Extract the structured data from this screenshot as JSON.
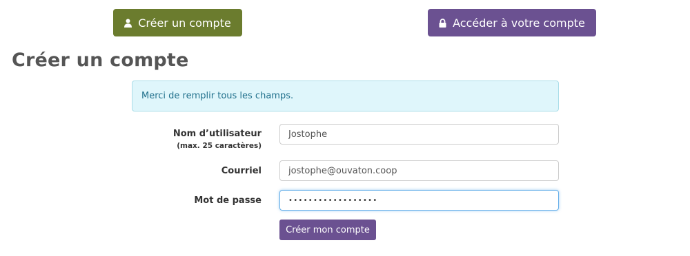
{
  "header": {
    "create_account_button": {
      "label": "Créer un compte",
      "icon": "user-icon"
    },
    "login_button": {
      "label": "Accéder à votre compte",
      "icon": "lock-icon"
    }
  },
  "page": {
    "title": "Créer un compte",
    "alert": "Merci de remplir tous les champs."
  },
  "form": {
    "username": {
      "label": "Nom d’utilisateur",
      "hint": "(max. 25 caractères)",
      "value": "Jostophe"
    },
    "email": {
      "label": "Courriel",
      "value": "jostophe@ouvaton.coop"
    },
    "password": {
      "label": "Mot de passe",
      "masked_value": "••••••••••••••••••"
    },
    "submit_label": "Créer mon compte"
  },
  "colors": {
    "create_button": "#6b7c2e",
    "login_button": "#6b5191",
    "alert_background": "#dff6fb",
    "alert_text": "#1f6f8b",
    "focus_border": "#66afe9"
  }
}
